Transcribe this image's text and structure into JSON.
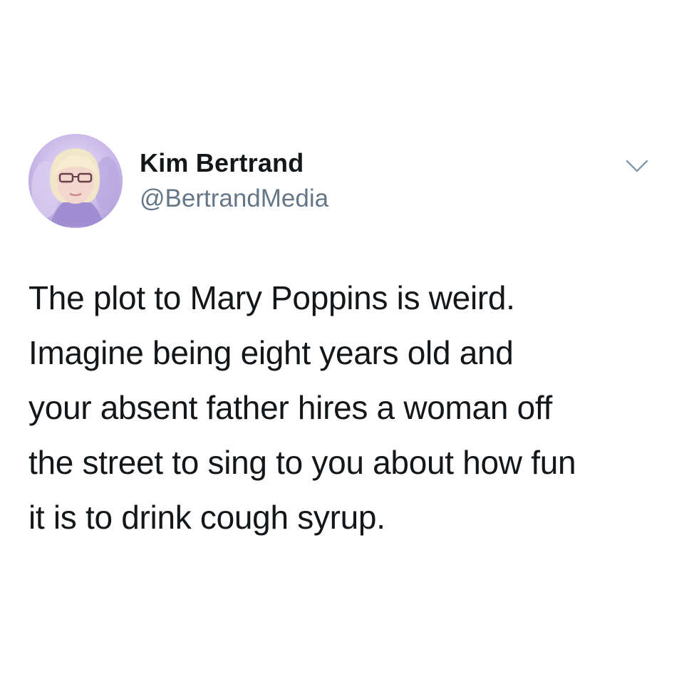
{
  "tweet": {
    "author": {
      "display_name": "Kim Bertrand",
      "handle": "@BertrandMedia",
      "avatar_icon": "profile-photo"
    },
    "menu_icon": "chevron-down-icon",
    "text_lines": [
      "The plot to Mary Poppins is weird.",
      "Imagine being eight years old and",
      "your absent father hires a woman off",
      "the street to sing to you about how fun",
      "it is to drink cough syrup."
    ]
  },
  "colors": {
    "background": "#ffffff",
    "text_primary": "#14171a",
    "text_secondary": "#657786",
    "avatar_tint": "#cdbfe6"
  }
}
